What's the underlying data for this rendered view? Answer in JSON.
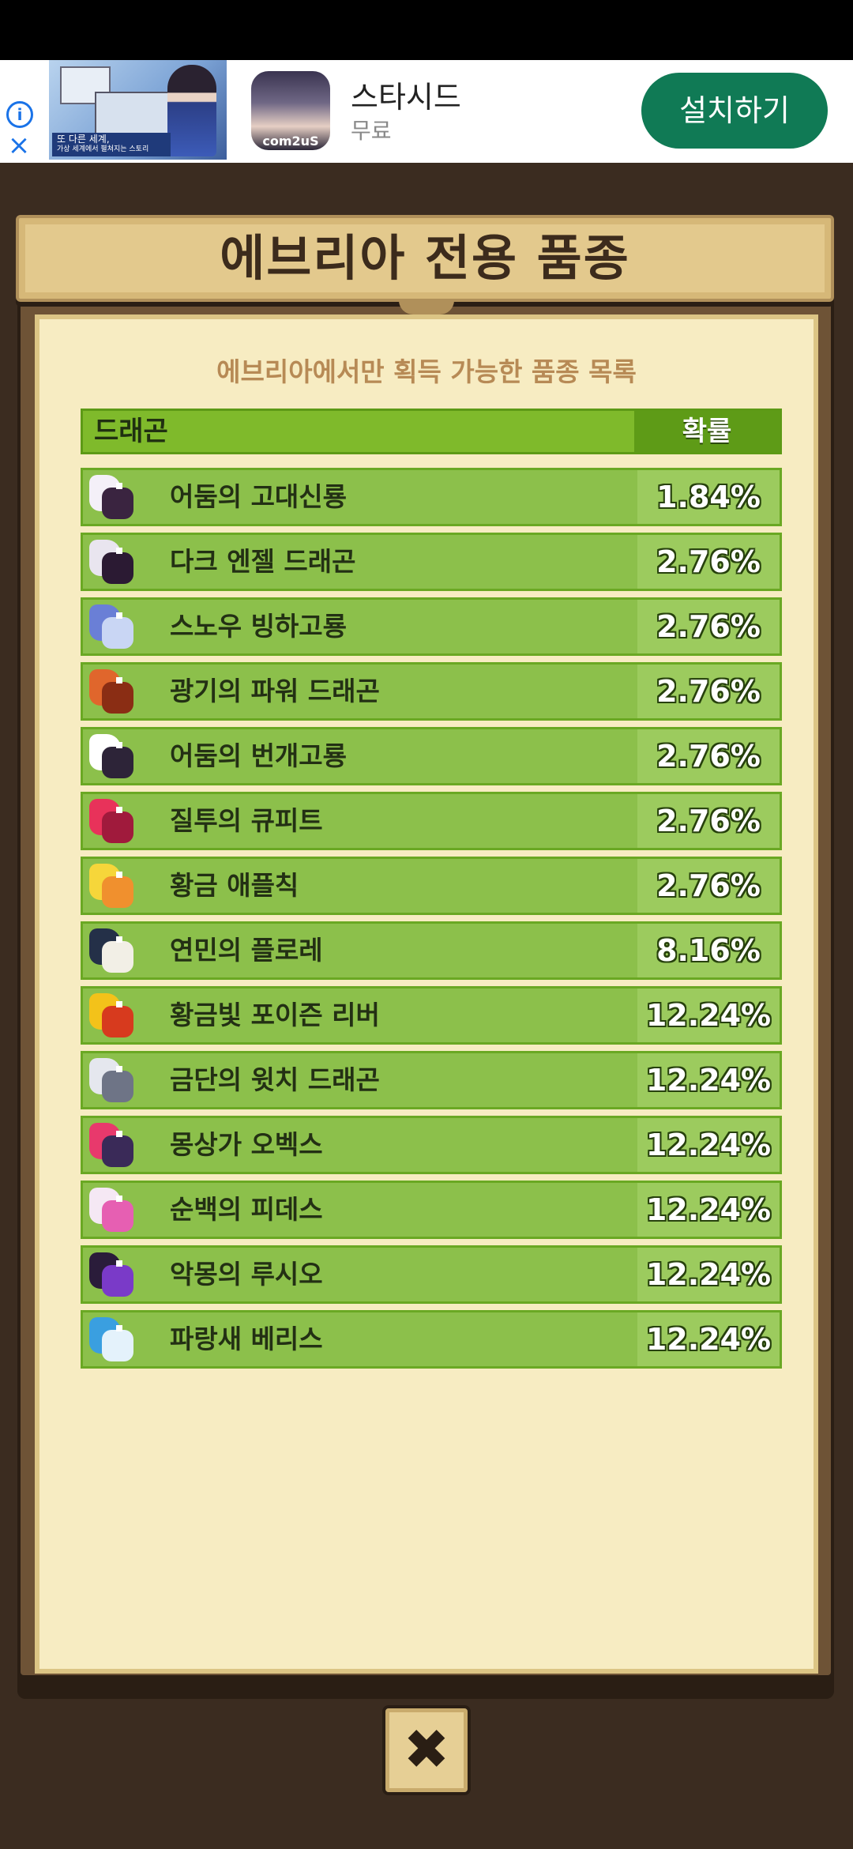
{
  "ad": {
    "preview_caption_line1": "또 다른 세계,",
    "preview_caption_line2": "가상 세계에서 펼쳐지는 스토리",
    "app_icon_brand": "com2uS",
    "app_name": "스타시드",
    "app_price": "무료",
    "install_label": "설치하기",
    "info_icon": "info-icon",
    "close_icon": "close-icon"
  },
  "dialog": {
    "title": "에브리아 전용 품종",
    "subtitle": "에브리아에서만 획득 가능한 품종 목록",
    "header_name": "드래곤",
    "header_prob": "확률",
    "close_symbol": "✖",
    "rows": [
      {
        "name": "어둠의 고대신룡",
        "prob": "1.84%",
        "c1": "#f4f0f8",
        "c2": "#3a2440"
      },
      {
        "name": "다크 엔젤 드래곤",
        "prob": "2.76%",
        "c1": "#e9e5ef",
        "c2": "#2b1a33"
      },
      {
        "name": "스노우 빙하고룡",
        "prob": "2.76%",
        "c1": "#6a7fd6",
        "c2": "#c9d6f4"
      },
      {
        "name": "광기의 파워 드래곤",
        "prob": "2.76%",
        "c1": "#e0662c",
        "c2": "#8a2d14"
      },
      {
        "name": "어둠의 번개고룡",
        "prob": "2.76%",
        "c1": "#ffffff",
        "c2": "#2d2438"
      },
      {
        "name": "질투의 큐피트",
        "prob": "2.76%",
        "c1": "#e8325a",
        "c2": "#a01a3c"
      },
      {
        "name": "황금 애플칙",
        "prob": "2.76%",
        "c1": "#f6d63a",
        "c2": "#f0902e"
      },
      {
        "name": "연민의 플로레",
        "prob": "8.16%",
        "c1": "#243048",
        "c2": "#f2efe6"
      },
      {
        "name": "황금빛 포이즌 리버",
        "prob": "12.24%",
        "c1": "#f3c21a",
        "c2": "#d73a1e"
      },
      {
        "name": "금단의 윗치 드래곤",
        "prob": "12.24%",
        "c1": "#e5e7ee",
        "c2": "#6e7486"
      },
      {
        "name": "몽상가 오벡스",
        "prob": "12.24%",
        "c1": "#e8396c",
        "c2": "#3a2a58"
      },
      {
        "name": "순백의 피데스",
        "prob": "12.24%",
        "c1": "#f5e8f4",
        "c2": "#e65fb2"
      },
      {
        "name": "악몽의 루시오",
        "prob": "12.24%",
        "c1": "#2a1c3a",
        "c2": "#7a3ac8"
      },
      {
        "name": "파랑새 베리스",
        "prob": "12.24%",
        "c1": "#3a9fe0",
        "c2": "#e4f2fb"
      }
    ]
  }
}
